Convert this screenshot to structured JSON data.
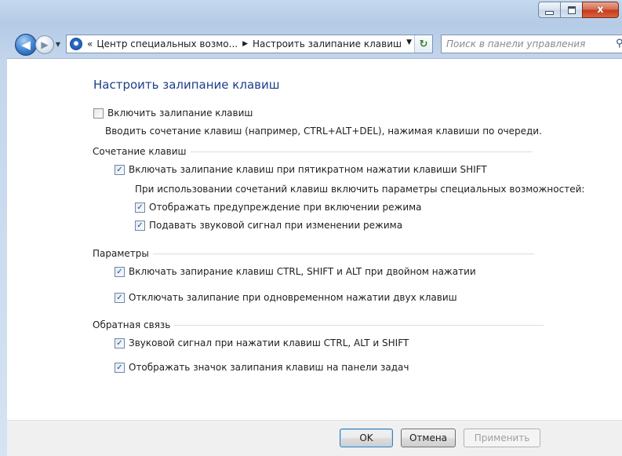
{
  "window": {
    "minimize_label": "",
    "maximize_label": "",
    "close_label": "x"
  },
  "nav": {
    "breadcrumb_prefix": "«",
    "crumbs": [
      "Центр специальных возмо...",
      "Настроить залипание клавиш"
    ],
    "separator": "▶",
    "search_placeholder": "Поиск в панели управления"
  },
  "main": {
    "title": "Настроить залипание клавиш",
    "enable": {
      "label": "Включить залипание клавиш",
      "checked": false
    },
    "enable_hint": "Вводить сочетание клавиш (например, CTRL+ALT+DEL), нажимая клавиши по очереди.",
    "groups": {
      "shortcut": {
        "title": "Сочетание клавиш",
        "shift5": {
          "label": "Включать залипание клавиш при пятикратном нажатии клавиши SHIFT",
          "checked": true
        },
        "note": "При использовании сочетаний клавиш включить параметры специальных возможностей:",
        "warn": {
          "label": "Отображать предупреждение при включении режима",
          "checked": true
        },
        "sound": {
          "label": "Подавать звуковой сигнал при изменении режима",
          "checked": true
        }
      },
      "options": {
        "title": "Параметры",
        "lock": {
          "label": "Включать запирание клавиш CTRL, SHIFT и ALT при двойном нажатии",
          "checked": true
        },
        "off_two": {
          "label": "Отключать залипание при одновременном нажатии двух клавиш",
          "checked": true
        }
      },
      "feedback": {
        "title": "Обратная связь",
        "beep": {
          "label": "Звуковой сигнал при нажатии клавиш CTRL, ALT и SHIFT",
          "checked": true
        },
        "taskbar": {
          "label": "Отображать значок залипания клавиш на панели задач",
          "checked": true
        }
      }
    }
  },
  "buttons": {
    "ok": "OK",
    "cancel": "Отмена",
    "apply": "Применить"
  }
}
